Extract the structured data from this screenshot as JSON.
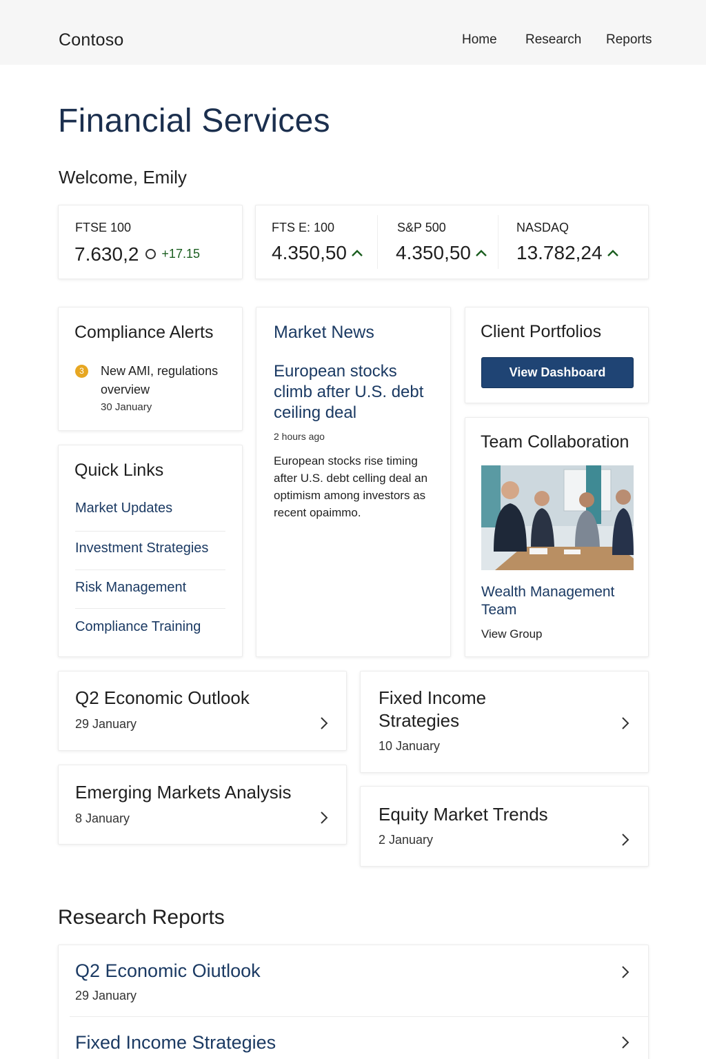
{
  "header": {
    "brand": "Contoso",
    "nav": [
      "Home",
      "Research",
      "Reports"
    ]
  },
  "page": {
    "title": "Financial Services",
    "welcome": "Welcome, Emily"
  },
  "indices": [
    {
      "name": "FTSE 100",
      "value": "7.630,2",
      "change": "+17.15",
      "indicator": "ring-icon"
    },
    {
      "name": "FTS E: 100",
      "value": "4.350,50",
      "indicator": "arrow-up-icon"
    },
    {
      "name": "S&P 500",
      "value": "4.350,50",
      "indicator": "arrow-up-icon"
    },
    {
      "name": "NASDAQ",
      "value": "13.782,24",
      "indicator": "arrow-up-icon"
    }
  ],
  "compliance": {
    "title": "Compliance Alerts",
    "badge": "3",
    "alert_text": "New AMI, regulations overview",
    "alert_date": "30 January"
  },
  "quick_links": {
    "title": "Quick Links",
    "items": [
      "Market Updates",
      "Investment Strategies",
      "Risk Management",
      "Compliance Training"
    ]
  },
  "market_news": {
    "title": "Market News",
    "headline": "European stocks climb after U.S. debt ceiling deal",
    "time": "2 hours ago",
    "body": "European stocks rise timing after U.S. debt celling deal an optimism among investors as recent opaimmo."
  },
  "client_portfolios": {
    "title": "Client Portfolios",
    "button": "View Dashboard"
  },
  "team": {
    "title": "Team Collaboration",
    "name": "Wealth Management Team",
    "link": "View Group"
  },
  "articles": [
    {
      "title": "Q2 Economic Outlook",
      "date": "29 January"
    },
    {
      "title": "Fixed Income Strategies",
      "date": "10 January"
    },
    {
      "title": "Emerging Markets Analysis",
      "date": "8 January"
    },
    {
      "title": "Equity Market Trends",
      "date": "2 January"
    }
  ],
  "research_reports": {
    "title": "Research Reports",
    "items": [
      {
        "title": "Q2 Economic Oiutlook",
        "date": "29 January"
      },
      {
        "title": "Fixed Income Strategies",
        "date": ""
      }
    ]
  },
  "colors": {
    "accent": "#1b3a63",
    "button": "#1f4474",
    "positive": "#1b5e20",
    "badge": "#e7a722"
  }
}
